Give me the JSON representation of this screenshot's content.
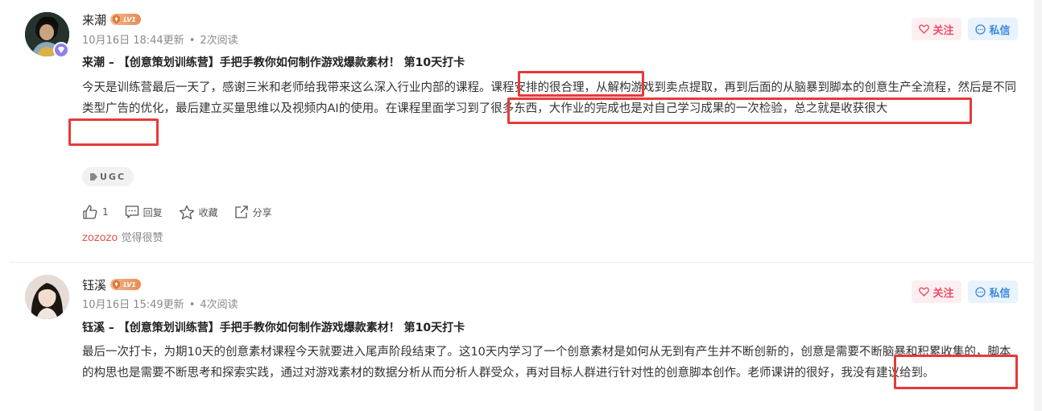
{
  "posts": [
    {
      "author": "来潮",
      "level": "LV1",
      "date": "10月16日 18:44更新",
      "reads": "2次阅读",
      "follow_label": "关注",
      "message_label": "私信",
      "title": "来潮 – 【创意策划训练营】手把手教你如何制作游戏爆款素材！ 第10天打卡",
      "content": "今天是训练营最后一天了，感谢三米和老师给我带来这么深入行业内部的课程。课程安排的很合理，从解构游戏到卖点提取，再到后面的从脑暴到脚本的创意生产全流程，然后是不同类型广告的优化，最后建立买量思维以及视频内AI的使用。在课程里面学习到了很多东西，大作业的完成也是对自己学习成果的一次检验，总之就是收获很大",
      "tag": "UGC",
      "like_count": "1",
      "reply_label": "回复",
      "collect_label": "收藏",
      "share_label": "分享",
      "liked_by_user": "zozozo",
      "liked_by_text": "觉得很赞"
    },
    {
      "author": "钰溪",
      "level": "LV1",
      "date": "10月16日 15:49更新",
      "reads": "4次阅读",
      "follow_label": "关注",
      "message_label": "私信",
      "title": "钰溪 – 【创意策划训练营】手把手教你如何制作游戏爆款素材！ 第10天打卡",
      "content": "最后一次打卡，为期10天的创意素材课程今天就要进入尾声阶段结束了。这10天内学习了一个创意素材是如何从无到有产生并不断创新的，创意是需要不断脑暴和积累收集的，脚本的构思也是需要不断思考和探索实践，通过对游戏素材的数据分析从而分析人群受众，再对目标人群进行针对性的创意脚本创作。老师课讲的很好，我没有建议给到。"
    }
  ],
  "colors": {
    "highlight": "#e63a3a",
    "follow": "#ec4e66",
    "message": "#3a86dd"
  }
}
